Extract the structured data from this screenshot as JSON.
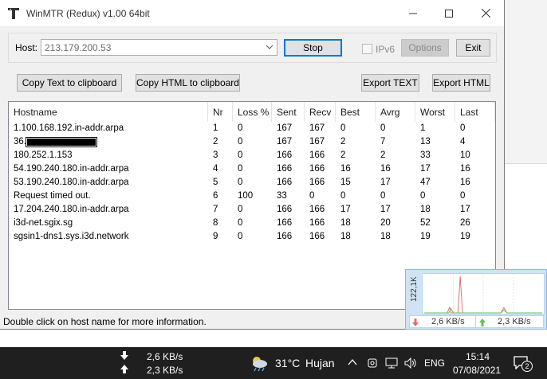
{
  "window": {
    "title": "WinMTR (Redux) v1.00 64bit"
  },
  "host": {
    "label": "Host:",
    "value": "213.179.200.53"
  },
  "buttons": {
    "stop": "Stop",
    "ipv6": "IPv6",
    "options": "Options",
    "exit": "Exit",
    "copy_text": "Copy Text to clipboard",
    "copy_html": "Copy HTML to clipboard",
    "export_text": "Export TEXT",
    "export_html": "Export HTML"
  },
  "results": {
    "columns": [
      "Hostname",
      "Nr",
      "Loss %",
      "Sent",
      "Recv",
      "Best",
      "Avrg",
      "Worst",
      "Last"
    ],
    "rows": [
      [
        "1.100.168.192.in-addr.arpa",
        "1",
        "0",
        "167",
        "167",
        "0",
        "0",
        "1",
        "0"
      ],
      [
        "36.",
        "2",
        "0",
        "167",
        "167",
        "2",
        "7",
        "13",
        "4"
      ],
      [
        "180.252.1.153",
        "3",
        "0",
        "166",
        "166",
        "2",
        "2",
        "33",
        "10"
      ],
      [
        "54.190.240.180.in-addr.arpa",
        "4",
        "0",
        "166",
        "166",
        "16",
        "16",
        "17",
        "16"
      ],
      [
        "53.190.240.180.in-addr.arpa",
        "5",
        "0",
        "166",
        "166",
        "15",
        "17",
        "47",
        "16"
      ],
      [
        "Request timed out.",
        "6",
        "100",
        "33",
        "0",
        "0",
        "0",
        "0",
        "0"
      ],
      [
        "17.204.240.180.in-addr.arpa",
        "7",
        "0",
        "166",
        "166",
        "17",
        "17",
        "18",
        "17"
      ],
      [
        "i3d-net.sgix.sg",
        "8",
        "0",
        "166",
        "166",
        "18",
        "20",
        "52",
        "26"
      ],
      [
        "sgsin1-dns1.sys.i3d.network",
        "9",
        "0",
        "166",
        "166",
        "18",
        "18",
        "19",
        "19"
      ]
    ]
  },
  "status": "Double click on host name for more information.",
  "traffic": {
    "axis_label": "122,1K",
    "download": "2,6 KB/s",
    "upload": "2,3 KB/s"
  },
  "taskbar": {
    "download": "2,6 KB/s",
    "upload": "2,3 KB/s",
    "weather_temp": "31°C",
    "weather_desc": "Hujan",
    "language": "ENG",
    "time": "15:14",
    "date": "07/08/2021",
    "notification_count": "2"
  },
  "colors": {
    "accent": "#0078d7",
    "taskbar": "#1f1f1f"
  }
}
